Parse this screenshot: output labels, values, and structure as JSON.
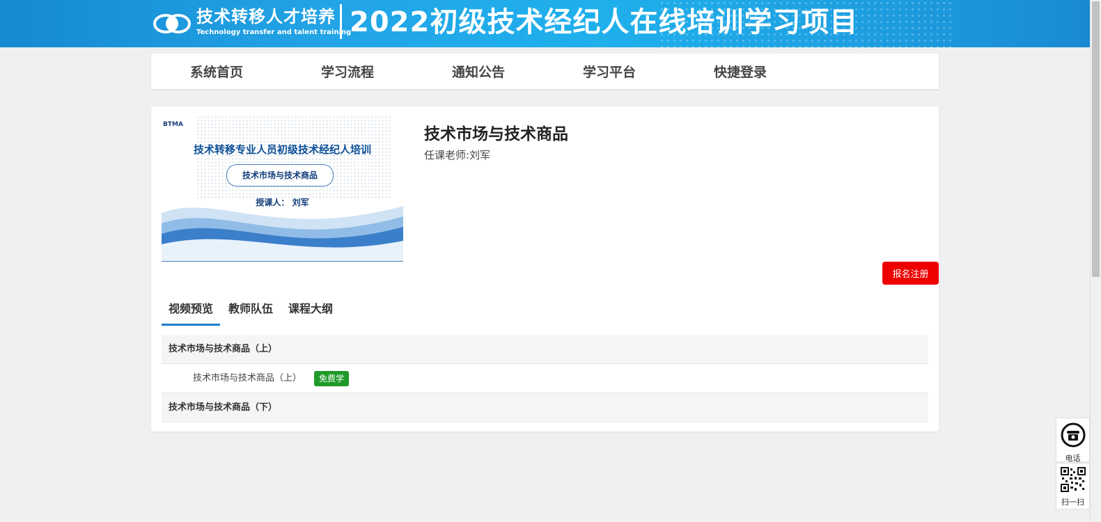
{
  "header": {
    "logo_cn": "技术转移人才培养",
    "logo_en": "Technology transfer and talent training",
    "title": "2022初级技术经纪人在线培训学习项目"
  },
  "nav": {
    "items": [
      {
        "label": "系统首页"
      },
      {
        "label": "学习流程"
      },
      {
        "label": "通知公告"
      },
      {
        "label": "学习平台"
      },
      {
        "label": "快捷登录"
      }
    ]
  },
  "course": {
    "cover": {
      "badge": "BTMA",
      "title": "技术转移专业人员初级技术经纪人培训",
      "pill": "技术市场与技术商品",
      "teacher": "授课人：  刘军"
    },
    "title": "技术市场与技术商品",
    "teacher": "任课老师:刘军",
    "register_label": "报名注册"
  },
  "tabs": [
    {
      "label": "视频预览",
      "active": true
    },
    {
      "label": "教师队伍",
      "active": false
    },
    {
      "label": "课程大纲",
      "active": false
    }
  ],
  "outline": {
    "chapter1": "技术市场与技术商品（上）",
    "lesson1": "技术市场与技术商品（上）",
    "lesson1_badge": "免费学",
    "chapter2": "技术市场与技术商品（下）"
  },
  "side": {
    "phone_label": "电话",
    "qr_label": "扫一扫"
  },
  "colors": {
    "banner": "#1f9ee2",
    "register": "#ee0000",
    "free_badge": "#1f9a2a",
    "tab_active": "#1e7fd0"
  }
}
